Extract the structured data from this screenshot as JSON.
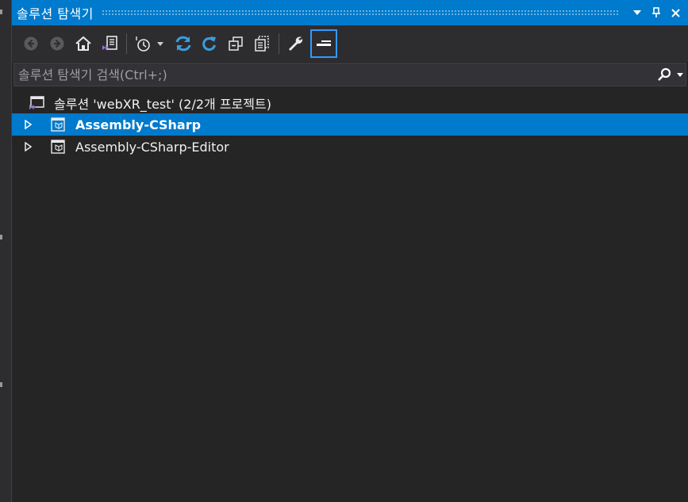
{
  "window": {
    "title": "솔루션 탐색기",
    "title_buttons": [
      "chevron-down-icon",
      "pin-icon",
      "close-icon"
    ]
  },
  "toolbar": {
    "buttons": [
      {
        "name": "back-button",
        "icon": "back-arrow-icon",
        "enabled": false
      },
      {
        "name": "forward-button",
        "icon": "forward-arrow-icon",
        "enabled": false
      },
      {
        "name": "home-button",
        "icon": "home-icon",
        "enabled": true
      },
      {
        "name": "switch-views-button",
        "icon": "switch-views-icon",
        "enabled": true
      },
      {
        "name": "pending-changes-filter-button",
        "icon": "clock-icon",
        "enabled": true
      },
      {
        "name": "sync-with-active-document-button",
        "icon": "sync-icon",
        "enabled": true
      },
      {
        "name": "refresh-button",
        "icon": "refresh-icon",
        "enabled": true
      },
      {
        "name": "collapse-all-button",
        "icon": "collapse-all-icon",
        "enabled": true
      },
      {
        "name": "show-all-files-button",
        "icon": "show-all-files-icon",
        "enabled": true
      },
      {
        "name": "properties-button",
        "icon": "wrench-icon",
        "enabled": true
      },
      {
        "name": "preview-selected-items-button",
        "icon": "preview-icon",
        "enabled": true,
        "active": true
      }
    ]
  },
  "search": {
    "placeholder": "솔루션 탐색기 검색(Ctrl+;)",
    "value": ""
  },
  "tree": {
    "solution": {
      "label": "솔루션 'webXR_test' (2/2개 프로젝트)",
      "icon": "visual-studio-solution-icon"
    },
    "projects": [
      {
        "label": "Assembly-CSharp",
        "icon": "csharp-project-icon",
        "selected": true,
        "expanded": false
      },
      {
        "label": "Assembly-CSharp-Editor",
        "icon": "csharp-project-icon",
        "selected": false,
        "expanded": false
      }
    ]
  },
  "colors": {
    "accent": "#007acc",
    "background": "#252526",
    "toolbar": "#2d2d30",
    "vs_purple": "#a074d6",
    "sync_blue": "#3b9ddd"
  }
}
